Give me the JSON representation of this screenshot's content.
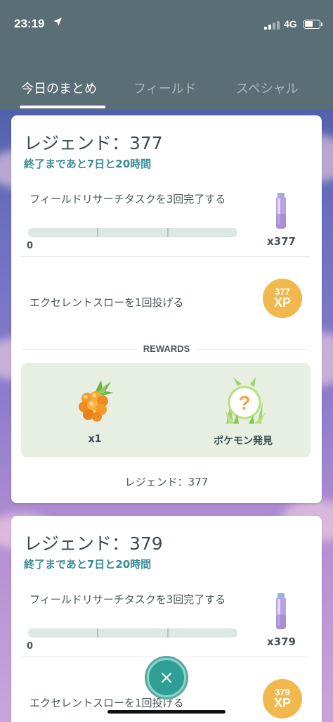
{
  "status_bar": {
    "time": "23:19",
    "network": "4G"
  },
  "tabs": [
    {
      "label": "今日のまとめ",
      "active": true
    },
    {
      "label": "フィールド",
      "active": false
    },
    {
      "label": "スペシャル",
      "active": false
    }
  ],
  "cards": [
    {
      "title": "レジェンド：377",
      "subtitle": "終了まであと7日と20時間",
      "tasks": [
        {
          "text": "フィールドリサーチタスクを3回完了する",
          "progress_value": "0",
          "progress_fraction": 0,
          "reward_qty": "x377",
          "reward_icon": "potion-icon"
        },
        {
          "text": "エクセレントスローを1回投げる",
          "xp_value": "377",
          "xp_unit": "XP"
        }
      ],
      "rewards_heading": "REWARDS",
      "rewards": [
        {
          "icon": "golden-razz-berry-icon",
          "label": "x1"
        },
        {
          "icon": "pokemon-encounter-icon",
          "label": "ポケモン発見"
        }
      ],
      "footer": "レジェンド：377"
    },
    {
      "title": "レジェンド：379",
      "subtitle": "終了まであと7日と20時間",
      "tasks": [
        {
          "text": "フィールドリサーチタスクを3回完了する",
          "progress_value": "0",
          "progress_fraction": 0,
          "reward_qty": "x379",
          "reward_icon": "potion-icon"
        },
        {
          "text": "エクセレントスローを1回投げる",
          "xp_value": "379",
          "xp_unit": "XP"
        }
      ]
    }
  ],
  "colors": {
    "header": "#5a6e75",
    "accent_teal": "#3a8c96",
    "xp_orange": "#f2b84e",
    "rewards_bg": "#e6efe1"
  }
}
